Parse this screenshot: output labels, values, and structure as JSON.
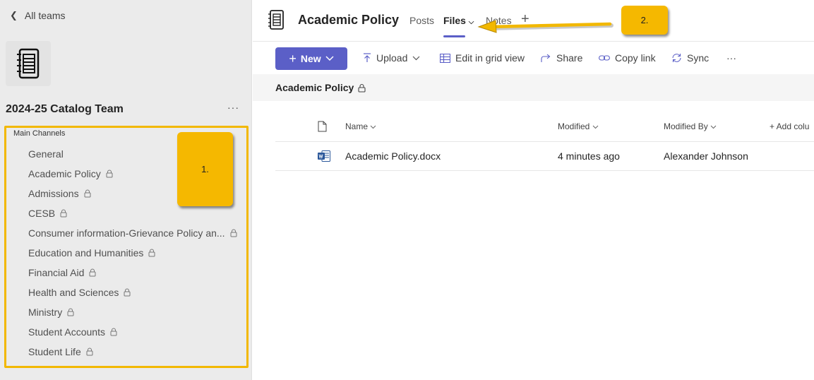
{
  "sidebar": {
    "back_label": "All teams",
    "team_name": "2024-25 Catalog Team",
    "more_label": "···",
    "section_label": "Main Channels",
    "channels": [
      {
        "label": "General"
      },
      {
        "label": "Academic Policy"
      },
      {
        "label": "Admissions"
      },
      {
        "label": "CESB"
      },
      {
        "label": "Consumer information-Grievance Policy an..."
      },
      {
        "label": "Education and Humanities"
      },
      {
        "label": "Financial Aid"
      },
      {
        "label": "Health and Sciences"
      },
      {
        "label": "Ministry"
      },
      {
        "label": "Student Accounts"
      },
      {
        "label": "Student Life"
      }
    ]
  },
  "callouts": {
    "one": "1.",
    "two": "2."
  },
  "header": {
    "channel_title": "Academic Policy",
    "tabs": {
      "posts": "Posts",
      "files": "Files",
      "notes": "Notes"
    },
    "add_tab": "+"
  },
  "toolbar": {
    "new_label": "New",
    "upload_label": "Upload",
    "grid_label": "Edit in grid view",
    "share_label": "Share",
    "copy_link_label": "Copy link",
    "sync_label": "Sync",
    "more_label": "···"
  },
  "breadcrumb": {
    "label": "Academic Policy"
  },
  "table": {
    "columns": {
      "name": "Name",
      "modified": "Modified",
      "modified_by": "Modified By",
      "add_column": "+ Add colu"
    },
    "rows": [
      {
        "name": "Academic Policy.docx",
        "modified": "4 minutes ago",
        "modified_by": "Alexander Johnson"
      }
    ]
  },
  "colors": {
    "accent": "#5b5fc7",
    "callout": "#f5b800",
    "highlight_border": "#f2b800",
    "sidebar_bg": "#ebebeb"
  },
  "icons": [
    "chevron-left-icon",
    "notebook-icon",
    "lock-icon",
    "plus-icon",
    "chevron-down-icon",
    "upload-icon",
    "grid-icon",
    "share-icon",
    "link-icon",
    "sync-icon",
    "file-icon",
    "word-doc-icon",
    "arrow-icon"
  ]
}
